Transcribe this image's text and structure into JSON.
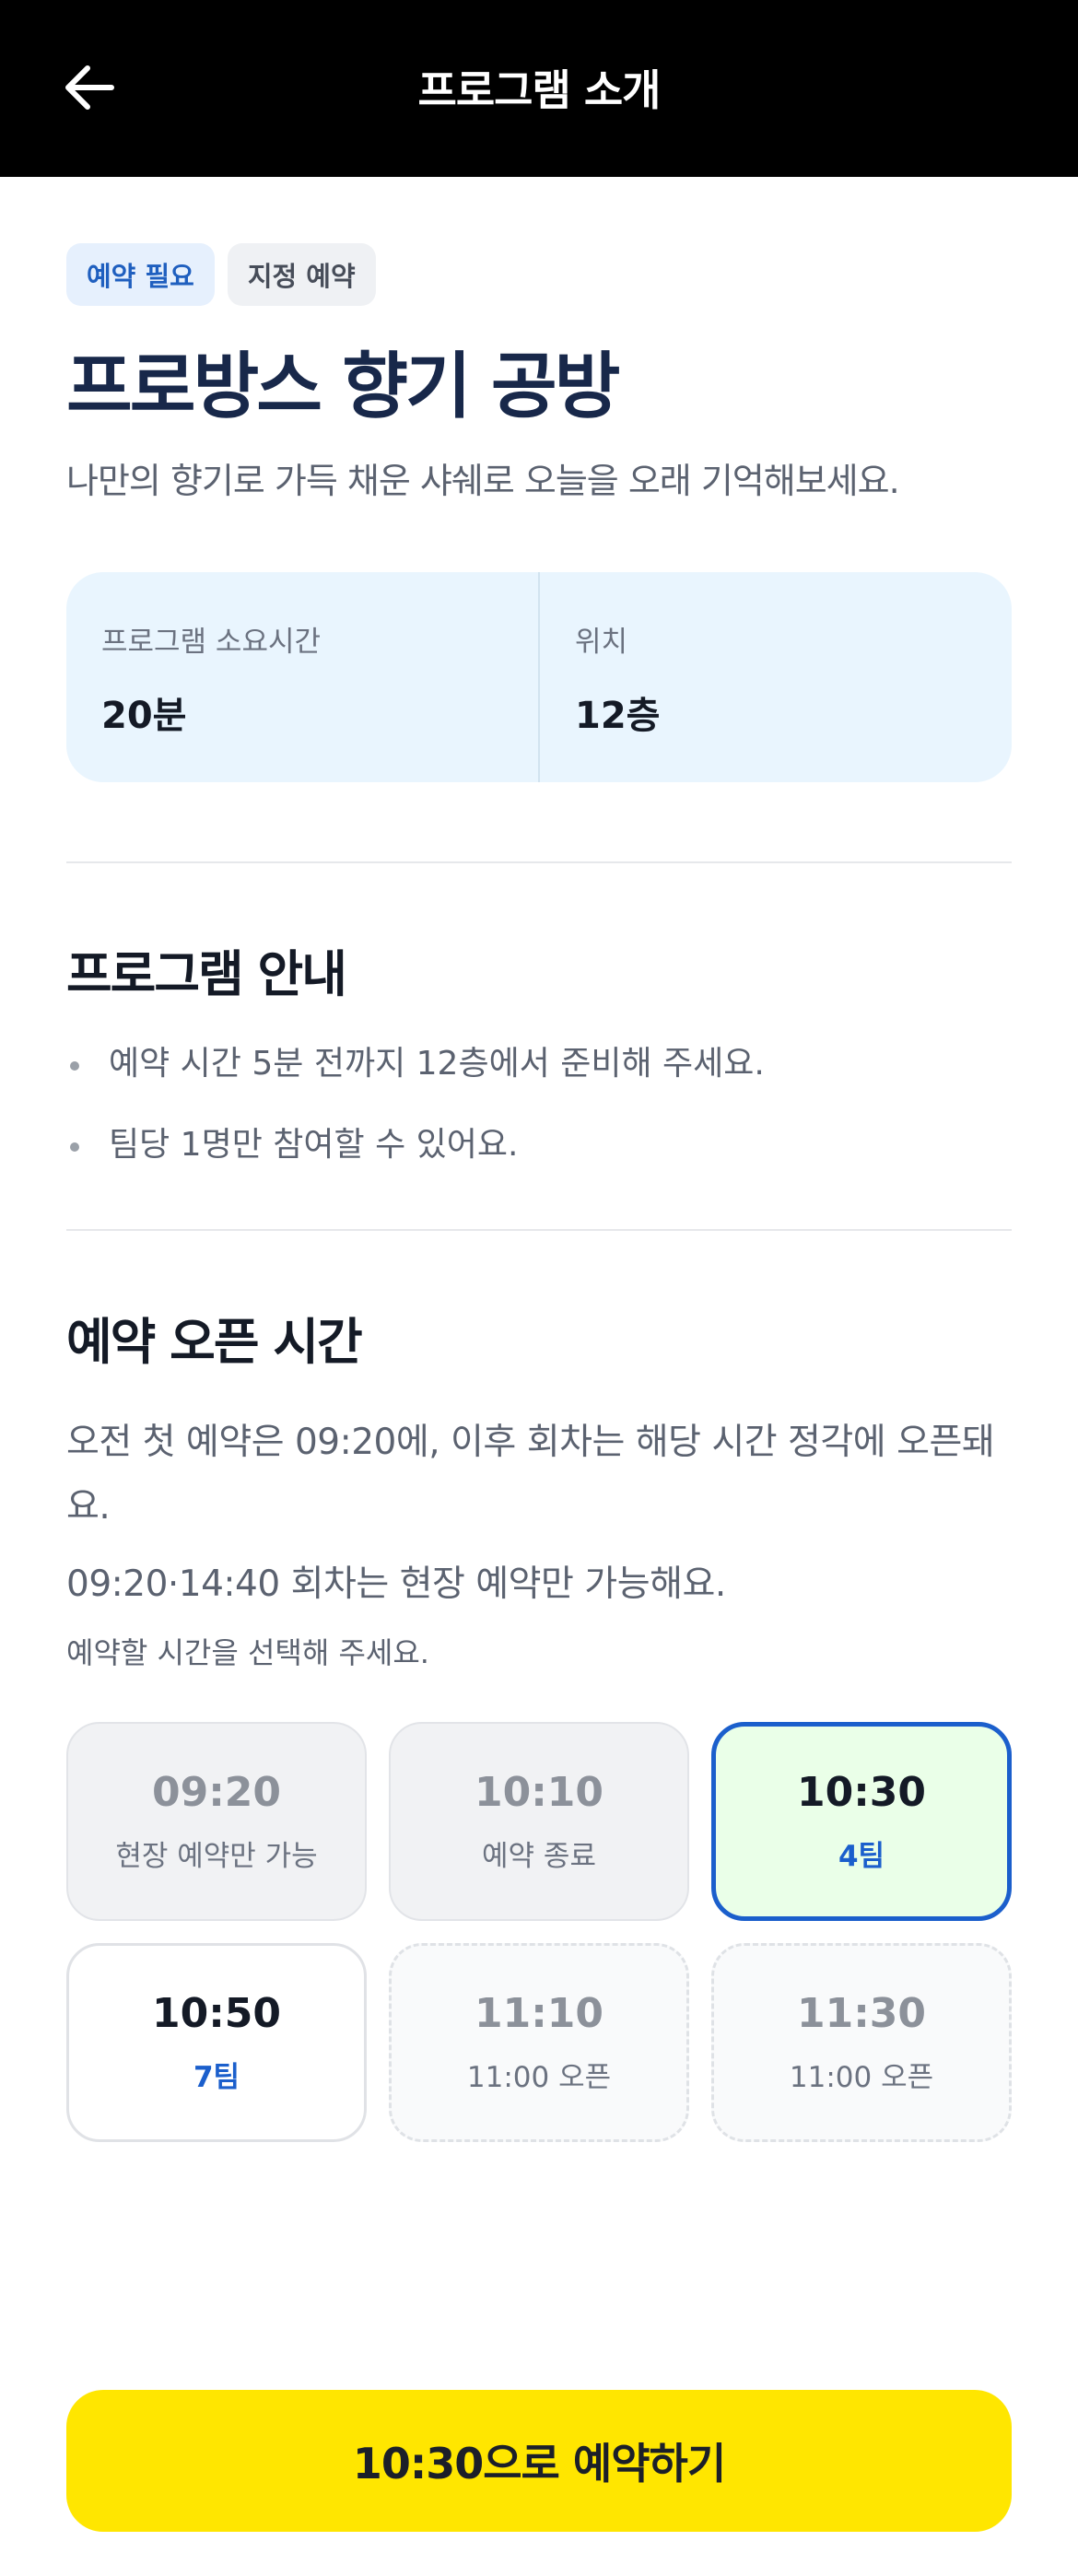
{
  "header": {
    "title": "프로그램 소개",
    "back_icon": "arrow-left-icon"
  },
  "badges": [
    {
      "label": "예약 필요",
      "style": "primary"
    },
    {
      "label": "지정 예약",
      "style": "secondary"
    }
  ],
  "program": {
    "title": "프로방스 향기 공방",
    "subtitle": "나만의 향기로 가득 채운 샤쉐로 오늘을 오래 기억해보세요."
  },
  "info": [
    {
      "label": "프로그램 소요시간",
      "value": "20분"
    },
    {
      "label": "위치",
      "value": "12층"
    }
  ],
  "guide": {
    "title": "프로그램 안내",
    "items": [
      "예약 시간 5분 전까지 12층에서 준비해 주세요.",
      "팀당 1명만 참여할 수 있어요."
    ]
  },
  "open_time": {
    "title": "예약 오픈 시간",
    "description": "오전 첫 예약은 09:20에, 이후 회차는 해당 시간 정각에 오픈돼요.",
    "note": "09:20·14:40 회차는 현장 예약만 가능해요.",
    "prompt": "예약할 시간을 선택해 주세요."
  },
  "slots": [
    {
      "time": "09:20",
      "sub": "현장 예약만 가능",
      "state": "closed"
    },
    {
      "time": "10:10",
      "sub": "예약 종료",
      "state": "closed"
    },
    {
      "time": "10:30",
      "sub": "4팀",
      "state": "selected"
    },
    {
      "time": "10:50",
      "sub": "7팀",
      "state": "available"
    },
    {
      "time": "11:10",
      "sub": "11:00 오픈",
      "state": "upcoming"
    },
    {
      "time": "11:30",
      "sub": "11:00 오픈",
      "state": "upcoming"
    }
  ],
  "cta": {
    "label": "10:30으로 예약하기"
  },
  "colors": {
    "header_bg": "#000000",
    "accent_blue": "#1b5fcc",
    "cta_yellow": "#ffe600",
    "title_navy": "#18284a"
  }
}
